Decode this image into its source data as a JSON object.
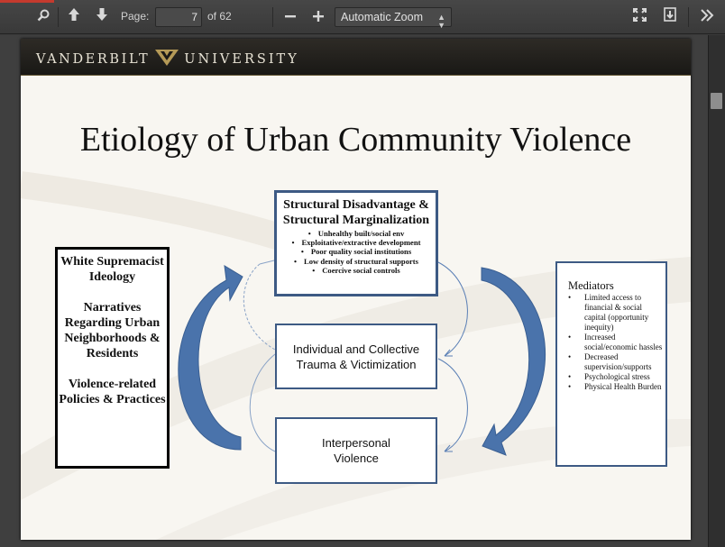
{
  "toolbar": {
    "page_label": "Page:",
    "page_value": "7",
    "page_total": "of 62",
    "zoom_value": "Automatic Zoom",
    "icons": {
      "search": "search-icon",
      "prev": "arrow-up-icon",
      "next": "arrow-down-icon",
      "zoom_out": "minus-icon",
      "zoom_in": "plus-icon",
      "fullscreen": "fullscreen-icon",
      "download": "download-icon",
      "tools": "double-chevron-right-icon"
    }
  },
  "slide": {
    "banner_left": "VANDERBILT",
    "banner_right": "UNIVERSITY",
    "title": "Etiology of Urban Community Violence",
    "left_box": {
      "p1": "White Supremacist Ideology",
      "p2": "Narratives Regarding Urban Neighborhoods & Residents",
      "p3": "Violence-related Policies & Practices"
    },
    "structural_box": {
      "title": "Structural Disadvantage & Structural Marginalization",
      "items": [
        "Unhealthy built/social env",
        "Exploitative/extractive development",
        "Poor quality social institutions",
        "Low density of structural supports",
        "Coercive social controls"
      ]
    },
    "trauma_box": "Individual and Collective Trauma & Victimization",
    "interpersonal_box": "Interpersonal Violence",
    "mediators_box": {
      "title": "Mediators",
      "items": [
        "Limited access to financial & social capital (opportunity inequity)",
        "Increased social/economic hassles",
        "Decreased supervision/supports",
        "Psychological stress",
        "Physical Health Burden"
      ]
    }
  },
  "colors": {
    "toolbar_bg": "#404040",
    "banner_bg": "#1f1d19",
    "arrow_blue": "#3f6aa3",
    "box_border": "#3d5a84"
  }
}
